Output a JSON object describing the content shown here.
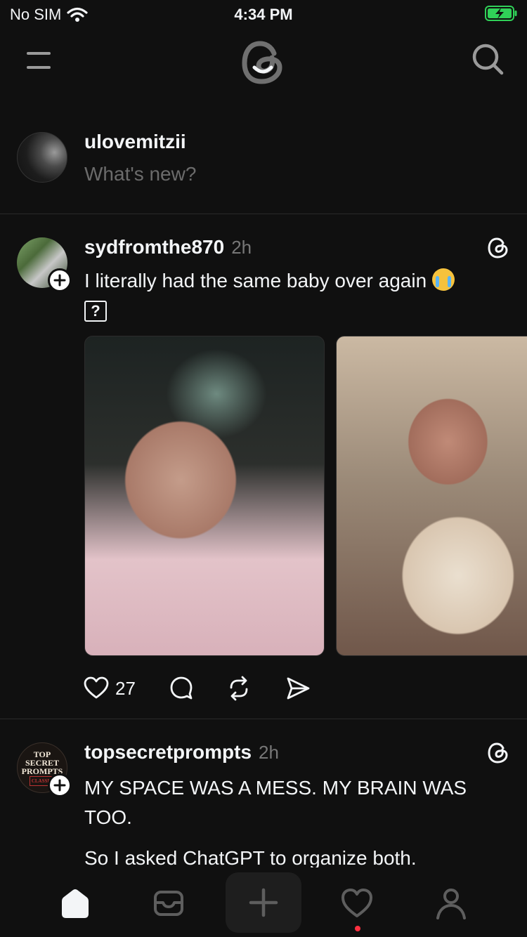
{
  "status_bar": {
    "carrier": "No SIM",
    "time": "4:34 PM",
    "battery_color": "#30d158"
  },
  "top_nav": {
    "menu_icon": "menu-icon",
    "logo_icon": "threads-logo-icon",
    "search_icon": "search-icon"
  },
  "composer": {
    "username": "ulovemitzii",
    "placeholder": "What's new?"
  },
  "feed": [
    {
      "author": "sydfromthe870",
      "time": "2h",
      "text": "I literally had the same baby over again",
      "glyph": "?",
      "media_count": 2,
      "like_count": "27"
    },
    {
      "author": "topsecretprompts",
      "time": "2h",
      "avatar_lines": [
        "TOP",
        "SECRET",
        "PROMPTS",
        "CLASSIC"
      ],
      "text": "MY SPACE WAS A MESS. MY BRAIN WAS TOO.",
      "text2": "So I asked ChatGPT to organize both."
    }
  ],
  "tab_bar": {
    "items": [
      "home-icon",
      "inbox-icon",
      "compose-icon",
      "activity-heart-icon",
      "profile-icon"
    ],
    "active": "home-icon",
    "notification_color": "#ff3040"
  }
}
